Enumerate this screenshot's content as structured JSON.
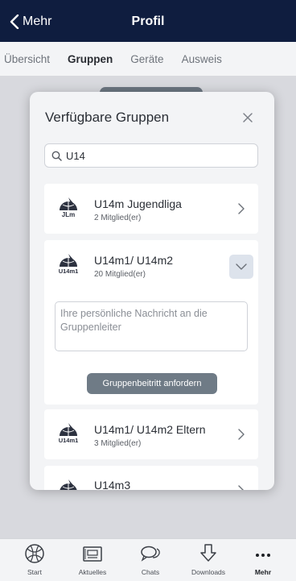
{
  "header": {
    "back_label": "Mehr",
    "title": "Profil"
  },
  "tabs": [
    {
      "label": "Übersicht",
      "active": false
    },
    {
      "label": "Gruppen",
      "active": true
    },
    {
      "label": "Geräte",
      "active": false
    },
    {
      "label": "Ausweis",
      "active": false
    }
  ],
  "modal": {
    "title": "Verfügbare Gruppen",
    "search_value": "U14",
    "groups": [
      {
        "logo_text": "JLm",
        "name": "U14m Jugendliga",
        "count": "2 Mitglied(er)",
        "expanded": false
      },
      {
        "logo_text": "U14m1",
        "name": "U14m1/ U14m2",
        "count": "20 Mitglied(er)",
        "expanded": true,
        "message_placeholder": "Ihre persönliche Nachricht an die Gruppenleiter",
        "request_label": "Gruppenbeitritt anfordern"
      },
      {
        "logo_text": "U14m1",
        "name": "U14m1/ U14m2 Eltern",
        "count": "3 Mitglied(er)",
        "expanded": false
      },
      {
        "logo_text": "",
        "name": "U14m3",
        "count": "",
        "expanded": false
      }
    ]
  },
  "tabbar": [
    {
      "label": "Start",
      "icon": "basketball-icon",
      "active": false
    },
    {
      "label": "Aktuelles",
      "icon": "newspaper-icon",
      "active": false
    },
    {
      "label": "Chats",
      "icon": "chat-bubbles-icon",
      "active": false
    },
    {
      "label": "Downloads",
      "icon": "download-arrow-icon",
      "active": false
    },
    {
      "label": "Mehr",
      "icon": "more-dots-icon",
      "active": true
    }
  ],
  "colors": {
    "navy": "#0f1d3f",
    "button_gray": "#6f7b86",
    "chevron_bg": "#dde3ec"
  }
}
